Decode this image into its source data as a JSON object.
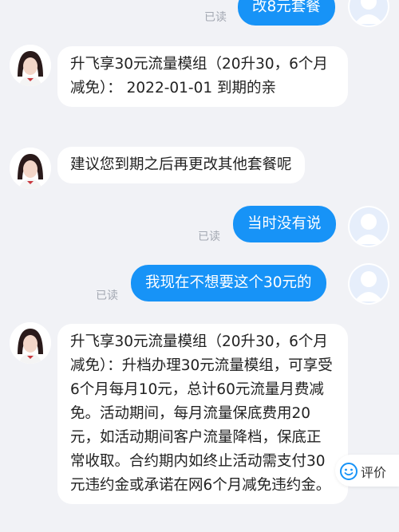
{
  "messages": {
    "m0": {
      "text": "改8元套餐",
      "read": "已读"
    },
    "m1": {
      "text": "升飞享30元流量模组（20升30，6个月减免）：  2022-01-01 到期的亲"
    },
    "m2": {
      "text": "建议您到期之后再更改其他套餐呢"
    },
    "m3": {
      "text": "当时没有说",
      "read": "已读"
    },
    "m4": {
      "text": "我现在不想要这个30元的",
      "read": "已读"
    },
    "m5": {
      "text": "升飞享30元流量模组（20升30，6个月减免）：升档办理30元流量模组，可享受6个月每月10元，总计60元流量月费减免。活动期间，每月流量保底费用20元，如活动期间客户流量降档，保底正常收取。合约期内如终止活动需支付30元违约金或承诺在网6个月减免违约金。"
    }
  },
  "rate_button": {
    "label": "评价",
    "icon": "smiley-icon"
  },
  "colors": {
    "my_bubble": "#1793f7",
    "background": "#f1f2f6",
    "read_text": "#a3a8b2"
  }
}
